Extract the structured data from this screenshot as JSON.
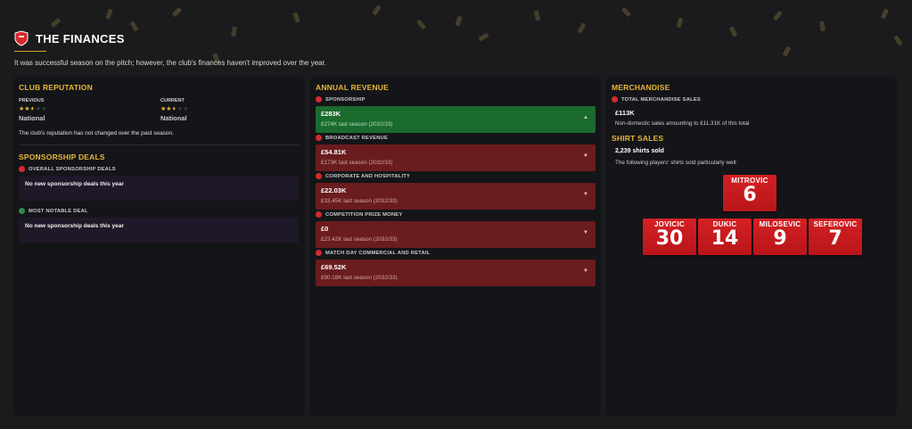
{
  "header": {
    "title": "THE FINANCES",
    "intro": "It was successful season on the pitch; however, the club's finances haven't improved over the year."
  },
  "club_reputation": {
    "title": "CLUB REPUTATION",
    "previous_label": "PREVIOUS",
    "previous_value": "National",
    "previous_stars": 2.5,
    "current_label": "CURRENT",
    "current_value": "National",
    "current_stars": 2.5,
    "note": "The club's reputation has not changed over the past season."
  },
  "sponsorship": {
    "title": "SPONSORSHIP DEALS",
    "overall_label": "OVERALL SPONSORSHIP DEALS",
    "overall_text": "No new sponsorship deals this year",
    "notable_label": "MOST NOTABLE DEAL",
    "notable_text": "No new sponsorship deals this year"
  },
  "annual_revenue": {
    "title": "ANNUAL REVENUE",
    "items": [
      {
        "label": "SPONSORSHIP",
        "value": "£283K",
        "last": "£274K last season (2032/33)",
        "trend": "up",
        "arrow": "▲"
      },
      {
        "label": "BROADCAST REVENUE",
        "value": "£54.81K",
        "last": "£173K last season (2032/33)",
        "trend": "down",
        "arrow": "▼"
      },
      {
        "label": "CORPORATE AND HOSPITALITY",
        "value": "£22.03K",
        "last": "£33.45K last season (2032/33)",
        "trend": "down",
        "arrow": "▼"
      },
      {
        "label": "COMPETITION PRIZE MONEY",
        "value": "£0",
        "last": "£23.42K last season (2032/33)",
        "trend": "down",
        "arrow": "▼"
      },
      {
        "label": "MATCH DAY COMMERCIAL AND RETAIL",
        "value": "£69.52K",
        "last": "£90.18K last season (2032/33)",
        "trend": "down",
        "arrow": "▼"
      }
    ]
  },
  "merchandise": {
    "title": "MERCHANDISE",
    "total_label": "TOTAL MERCHANDISE SALES",
    "total_value": "£113K",
    "total_note": "Non-domestic sales amounting to £11.31K of this total",
    "shirt_title": "SHIRT SALES",
    "shirts_sold": "2,239 shirts sold",
    "shirts_note": "The following players' shirts sold particularly well:",
    "shirts": [
      {
        "name": "MITROVIC",
        "number": "6"
      },
      {
        "name": "JOVICIC",
        "number": "30"
      },
      {
        "name": "DUKIC",
        "number": "14"
      },
      {
        "name": "MILOSEVIC",
        "number": "9"
      },
      {
        "name": "SEFEROVIC",
        "number": "7"
      }
    ]
  },
  "colors": {
    "accent": "#e8b63a",
    "positive": "#1b6b2f",
    "negative": "#6a1c1e",
    "shirt": "#d42024"
  }
}
